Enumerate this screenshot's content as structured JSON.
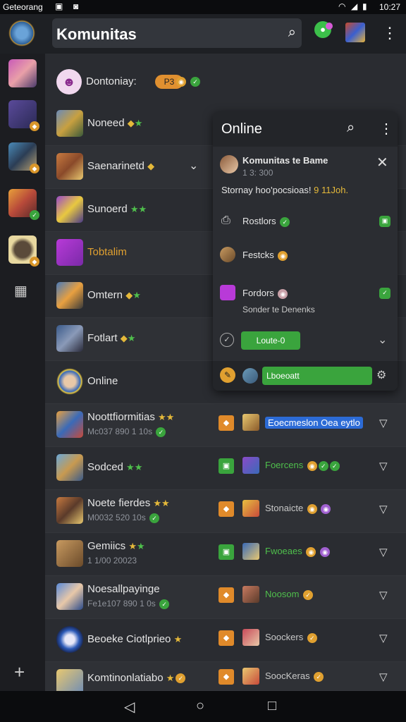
{
  "status_bar": {
    "left_text": "Geteorang",
    "time": "10:27"
  },
  "app_bar": {
    "title": "Komunitas"
  },
  "header_row": {
    "label": "Dontoniay:",
    "pill": "P3"
  },
  "rows": [
    {
      "name": "Noneed"
    },
    {
      "name": "Saenarinetd"
    },
    {
      "name": "Sunoerd"
    },
    {
      "name": "Tobtalim"
    },
    {
      "name": "Omtern"
    },
    {
      "name": "Fotlart"
    },
    {
      "name": "Online"
    }
  ],
  "list_rows": [
    {
      "name": "Noottfiormitias",
      "sub": "Mc037 890 1 10s",
      "right": "Eoecmeslon Oea eytlo"
    },
    {
      "name": "Sodced",
      "sub": "",
      "right": "Foercens"
    },
    {
      "name": "Noete fierdes",
      "sub": "M0032 520 10s",
      "right": "Stonaicte"
    },
    {
      "name": "Gemiics",
      "sub": "1 1/00 20023",
      "right": "Fwoeaes"
    },
    {
      "name": "Noesallpayinge",
      "sub": "Fe1e107 890 1 0s",
      "right": "Noosom"
    },
    {
      "name": "Beoeke Ciotlprieo",
      "sub": "",
      "right": "Soockers"
    },
    {
      "name": "Komtinonlatiabo",
      "sub": "",
      "right": "SoocKeras"
    }
  ],
  "popup": {
    "title": "Online",
    "group_name": "Komunitas te Bame",
    "group_meta": "1 3:  300",
    "message": "Stornay hoo'pocsioas!",
    "message_tag": "9 11Joh.",
    "items": [
      {
        "label": "Rostlors"
      },
      {
        "label": "Festcks"
      },
      {
        "label": "Fordors",
        "sub": "Sonder te Denenks"
      }
    ],
    "button_label": "Loute-0",
    "input_label": "Lboeoatt"
  },
  "colors": {
    "accent_green": "#3aa43d",
    "accent_orange": "#e08a2a",
    "link_blue": "#2c6bd6"
  }
}
